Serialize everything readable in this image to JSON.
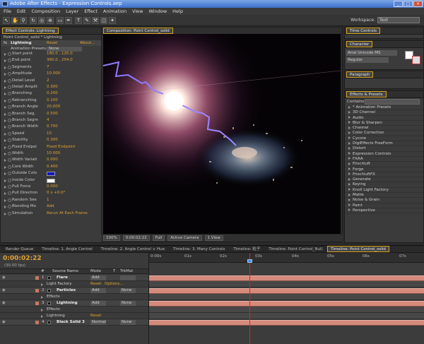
{
  "app": {
    "title": "Adobe After Effects - Expression Controls.aep"
  },
  "menu": [
    "File",
    "Edit",
    "Composition",
    "Layer",
    "Effect",
    "Animation",
    "View",
    "Window",
    "Help"
  ],
  "workspace": {
    "label": "Workspace:",
    "value": "Text"
  },
  "effect_controls": {
    "tab_label": "Effect Controls: Lightning",
    "subtitle": "Point Control_solid * Lightning",
    "effect_name": "Lightning",
    "reset": "Reset",
    "about": "About...",
    "preset_label": "Animation Presets:",
    "preset_value": "None",
    "params": [
      {
        "name": "Start point",
        "value": "180.0 , 120.0"
      },
      {
        "name": "End point",
        "value": "360.0 , 254.0"
      },
      {
        "name": "Segments",
        "value": "7"
      },
      {
        "name": "Amplitude",
        "value": "10.000"
      },
      {
        "name": "Detail Level",
        "value": "2"
      },
      {
        "name": "Detail Amplit",
        "value": "0.300"
      },
      {
        "name": "Branching",
        "value": "0.200"
      },
      {
        "name": "Rebranching",
        "value": "0.100"
      },
      {
        "name": "Branch Angle",
        "value": "20.000"
      },
      {
        "name": "Branch Seg.",
        "value": "0.500"
      },
      {
        "name": "Branch Segm",
        "value": "4"
      },
      {
        "name": "Branch Width",
        "value": "0.700"
      },
      {
        "name": "Speed",
        "value": "10"
      },
      {
        "name": "Stability",
        "value": "0.300"
      },
      {
        "name": "Fixed Endpoi",
        "value": "Fixed Endpoint"
      },
      {
        "name": "Width",
        "value": "10.000"
      },
      {
        "name": "Width Variati",
        "value": "0.000"
      },
      {
        "name": "Core Width",
        "value": "0.400"
      },
      {
        "name": "Outside Colo",
        "value": ""
      },
      {
        "name": "Inside Color",
        "value": ""
      },
      {
        "name": "Pull Force",
        "value": "0.000"
      },
      {
        "name": "Pull Direction",
        "value": "0 x +0.0°"
      },
      {
        "name": "Random See",
        "value": "1"
      },
      {
        "name": "Blending Mo",
        "value": "Add"
      },
      {
        "name": "Simulation",
        "value": "Rerun At Each Frame"
      }
    ]
  },
  "composition": {
    "tab_label": "Composition: Point Control_solid",
    "controls": {
      "zoom": "100%",
      "time": "0:00:02:22",
      "quality": "Full",
      "camera": "Active Camera",
      "views": "1 View"
    }
  },
  "right_panels": {
    "time_controls": "Time Controls",
    "character": "Character",
    "font": "Arial Unicode MS",
    "style": "Regular",
    "paragraph": "Paragraph",
    "effects_presets": "Effects & Presets",
    "contains_label": "Contains:",
    "categories": [
      "* Animation Presets",
      "3D Channel",
      "Audio",
      "Blur & Sharpen",
      "Channel",
      "Color Correction",
      "Cycore",
      "DigiEffects FreeForm",
      "Distort",
      "Expression Controls",
      "FXAA",
      "Frischluft",
      "Forge",
      "FrischluftFX",
      "Generate",
      "Keying",
      "Knoll Light Factory",
      "Matte",
      "Noise & Grain",
      "Paint",
      "Perspective"
    ]
  },
  "timeline": {
    "tabs": [
      "Render Queue",
      "Timeline: 1. Angle Control",
      "Timeline: 2. Angle Control + Hue",
      "Timeline: 3. Many Controls",
      "Timeline: 粒子",
      "Timeline: Point Control_Null",
      "Timeline: Point Control_solid"
    ],
    "timecode": "0:00:02:22",
    "fps": "(30.00 fps)",
    "headers": {
      "num": "#",
      "source": "Source Name",
      "mode": "Mode",
      "t": "T",
      "trkmat": "TrkMat"
    },
    "ruler": [
      "0:00s",
      "01s",
      "02s",
      "03s",
      "04s",
      "05s",
      "06s",
      "07s"
    ],
    "layers": [
      {
        "num": "1",
        "name": "Flare",
        "mode": "Add",
        "trk": "",
        "sub": [
          {
            "label": "Light Factory",
            "reset": "Reset",
            "extra": "Options..."
          }
        ]
      },
      {
        "num": "2",
        "name": "Particles",
        "mode": "Add",
        "trk": "None",
        "sub": [
          {
            "label": "Effects",
            "reset": "",
            "extra": ""
          }
        ]
      },
      {
        "num": "3",
        "name": "Lightning",
        "mode": "Add",
        "trk": "None",
        "sub": [
          {
            "label": "Effects",
            "reset": "",
            "extra": ""
          },
          {
            "label": "Lightning",
            "reset": "Reset",
            "extra": ""
          }
        ]
      },
      {
        "num": "4",
        "name": "Black Solid 3",
        "mode": "Normal",
        "trk": "None",
        "sub": []
      }
    ]
  },
  "colors": {
    "accent": "#d9a520",
    "layer_bar": "#d58a7c",
    "cti": "#dd2222",
    "value": "#e1a331"
  }
}
